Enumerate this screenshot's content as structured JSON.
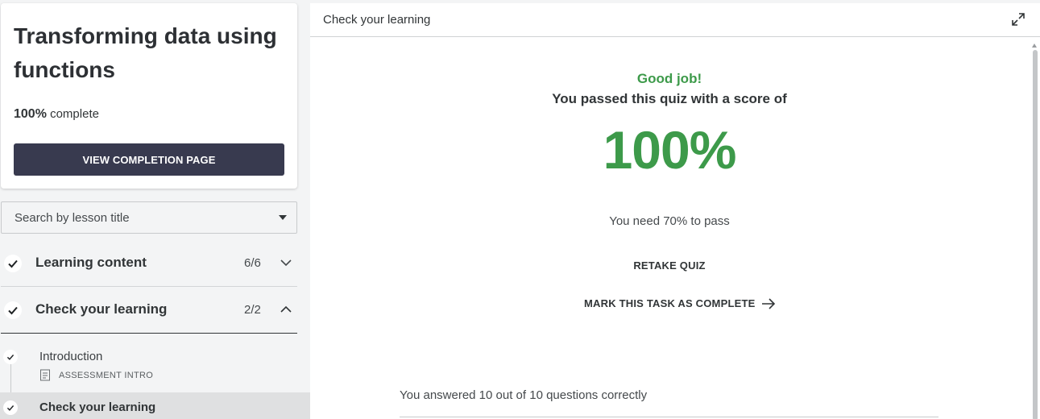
{
  "sidebar": {
    "course_title": "Transforming data using functions",
    "progress_percent": "100%",
    "progress_suffix": "complete",
    "completion_button": "VIEW COMPLETION PAGE",
    "search_placeholder": "Search by lesson title",
    "sections": [
      {
        "label": "Learning content",
        "count": "6/6",
        "expanded": false
      },
      {
        "label": "Check your learning",
        "count": "2/2",
        "expanded": true
      }
    ],
    "lessons": [
      {
        "title": "Introduction",
        "type": "ASSESSMENT INTRO",
        "icon": "document-icon"
      },
      {
        "title": "Check your learning",
        "active": true
      }
    ]
  },
  "main": {
    "header_title": "Check your learning",
    "result_heading": "Good job!",
    "result_text": "You passed this quiz with a score of",
    "score": "100%",
    "pass_requirement": "You need 70% to pass",
    "retake_label": "RETAKE QUIZ",
    "mark_complete_label": "MARK THIS TASK AS COMPLETE",
    "answered_summary": "You answered 10 out of 10 questions correctly"
  },
  "colors": {
    "accent_green": "#3d9a4a",
    "button_dark": "#383a4f",
    "sidebar_bg": "#f3f4f5"
  }
}
